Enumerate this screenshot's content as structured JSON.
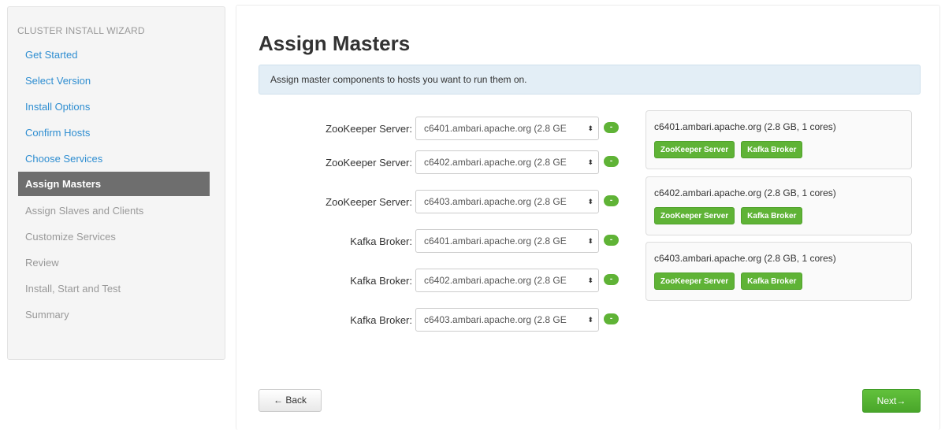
{
  "sidebar": {
    "heading": "CLUSTER INSTALL WIZARD",
    "items": [
      {
        "label": "Get Started"
      },
      {
        "label": "Select Version"
      },
      {
        "label": "Install Options"
      },
      {
        "label": "Confirm Hosts"
      },
      {
        "label": "Choose Services"
      },
      {
        "label": "Assign Masters"
      },
      {
        "label": "Assign Slaves and Clients"
      },
      {
        "label": "Customize Services"
      },
      {
        "label": "Review"
      },
      {
        "label": "Install, Start and Test"
      },
      {
        "label": "Summary"
      }
    ]
  },
  "main": {
    "title": "Assign Masters",
    "info": "Assign master components to hosts you want to run them on.",
    "assignments": [
      {
        "label": "ZooKeeper Server:",
        "value": "c6401.ambari.apache.org (2.8 GE"
      },
      {
        "label": "ZooKeeper Server:",
        "value": "c6402.ambari.apache.org (2.8 GE"
      },
      {
        "label": "ZooKeeper Server:",
        "value": "c6403.ambari.apache.org (2.8 GE"
      },
      {
        "label": "Kafka Broker:",
        "value": "c6401.ambari.apache.org (2.8 GE"
      },
      {
        "label": "Kafka Broker:",
        "value": "c6402.ambari.apache.org (2.8 GE"
      },
      {
        "label": "Kafka Broker:",
        "value": "c6403.ambari.apache.org (2.8 GE"
      }
    ],
    "remove_symbol": "-",
    "select_arrow": "⬍",
    "hosts": [
      {
        "name": "c6401.ambari.apache.org (2.8 GB, 1 cores)",
        "components": [
          "ZooKeeper Server",
          "Kafka Broker"
        ]
      },
      {
        "name": "c6402.ambari.apache.org (2.8 GB, 1 cores)",
        "components": [
          "ZooKeeper Server",
          "Kafka Broker"
        ]
      },
      {
        "name": "c6403.ambari.apache.org (2.8 GB, 1 cores)",
        "components": [
          "ZooKeeper Server",
          "Kafka Broker"
        ]
      }
    ]
  },
  "footer": {
    "back_label": "← Back",
    "next_label": "Next→"
  },
  "colors": {
    "link": "#2f8ed1",
    "active_nav": "#6e6e6e",
    "green": "#5fb336",
    "info_bg": "#e3eef6"
  }
}
